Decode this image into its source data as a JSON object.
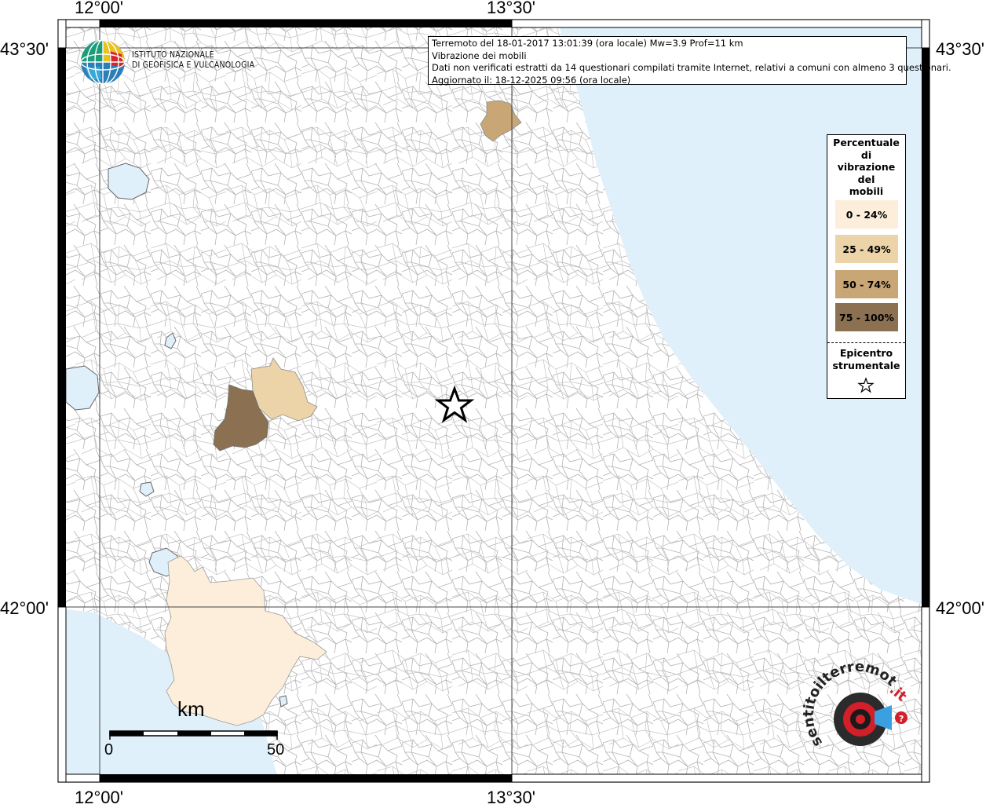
{
  "map": {
    "lon_labels": [
      "12°00'",
      "13°30'"
    ],
    "lat_labels": [
      "43°30'",
      "42°00'"
    ]
  },
  "info": {
    "line1": "Terremoto del 18-01-2017 13:01:39 (ora locale) Mw=3.9 Prof=11 km",
    "line2": "Vibrazione dei mobili",
    "line3": "Dati non verificati estratti da 14 questionari compilati tramite Internet, relativi a comuni con almeno 3 questionari.",
    "line4": "Aggiornato il: 18-12-2025 09:56 (ora locale)"
  },
  "ingv": {
    "line1": "ISTITUTO NAZIONALE",
    "line2": "DI GEOFISICA E VULCANOLOGIA"
  },
  "legend": {
    "title_lines": [
      "Percentuale",
      "di",
      "vibrazione",
      "del",
      "mobili"
    ],
    "items": [
      {
        "label": "0 - 24%",
        "color": "#fdeedb"
      },
      {
        "label": "25 - 49%",
        "color": "#ecd4a8"
      },
      {
        "label": "50 - 74%",
        "color": "#c9a676"
      },
      {
        "label": "75 - 100%",
        "color": "#8b7152"
      }
    ],
    "epicenter_lines": [
      "Epicentro",
      "strumentale"
    ]
  },
  "scale": {
    "unit": "km",
    "min": "0",
    "max": "50"
  },
  "colors": {
    "sea": "#dff0fb",
    "boundary": "#a8a8a8",
    "frame": "#000000"
  }
}
